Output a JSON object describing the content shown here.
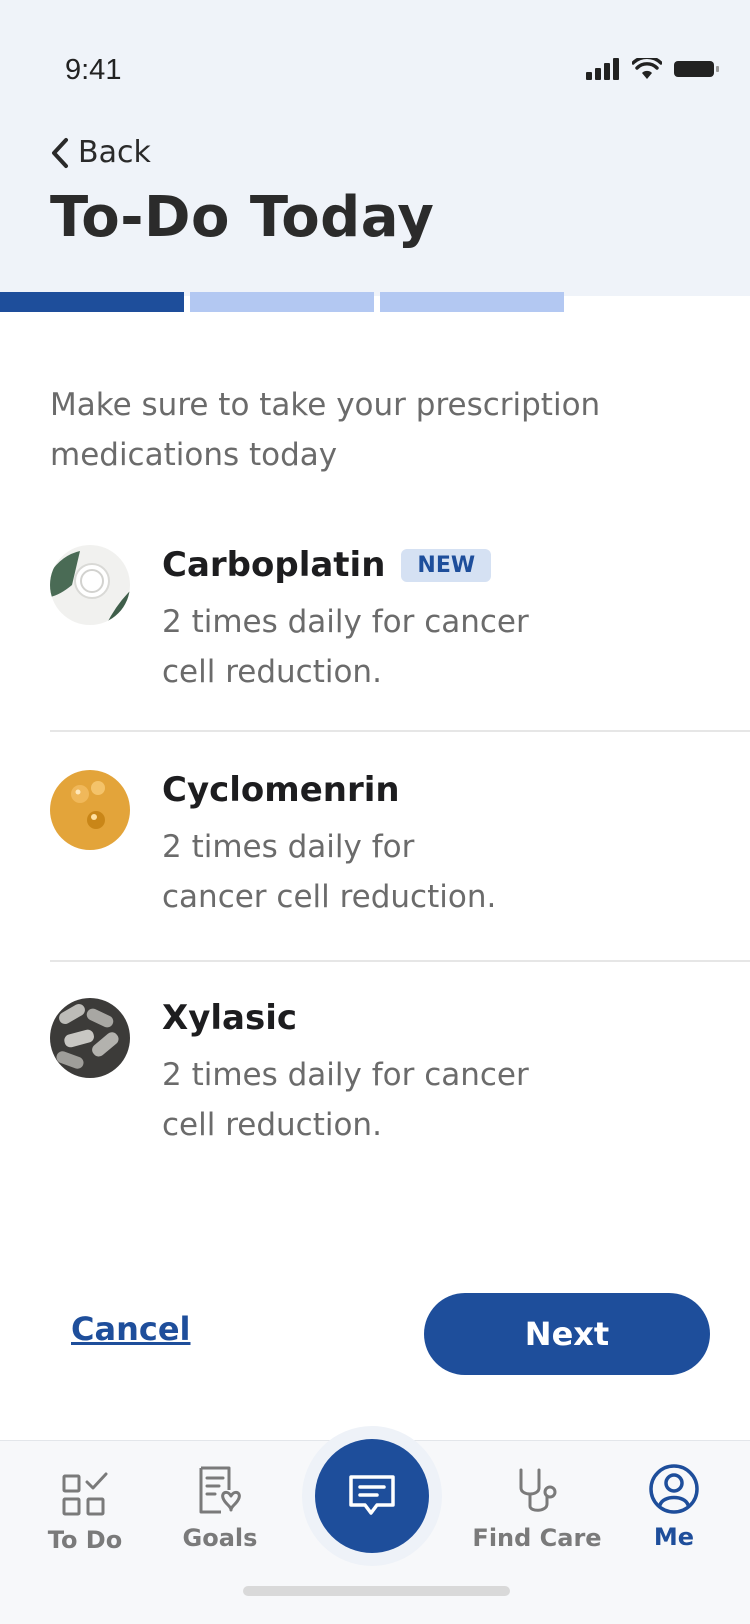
{
  "status_bar": {
    "time": "9:41"
  },
  "nav": {
    "back_label": "Back"
  },
  "page": {
    "title": "To-Do Today"
  },
  "progress": {
    "total_steps": 3,
    "completed_steps": 1
  },
  "intro_text": "Make sure to take your prescription medications today",
  "medications": [
    {
      "name": "Carboplatin",
      "badge": "NEW",
      "desc_line1": "2 times daily for cancer",
      "desc_line2": "cell reduction."
    },
    {
      "name": "Cyclomenrin",
      "desc_line1": "2 times daily for",
      "desc_line2": "cancer cell reduction."
    },
    {
      "name": "Xylasic",
      "desc_line1": "2 times daily for cancer",
      "desc_line2": "cell reduction."
    }
  ],
  "actions": {
    "cancel_label": "Cancel",
    "next_label": "Next"
  },
  "tabbar": {
    "items": [
      {
        "label": "To Do",
        "icon": "todo-grid-check-icon"
      },
      {
        "label": "Goals",
        "icon": "goals-document-icon"
      },
      {
        "label": "",
        "icon": "chat-bubble-icon"
      },
      {
        "label": "Find Care",
        "icon": "stethoscope-icon"
      },
      {
        "label": "Me",
        "icon": "user-circle-icon"
      }
    ],
    "active": "Me"
  },
  "colors": {
    "primary": "#1e4e9b",
    "progress_inactive": "#b3c8f2",
    "header_bg": "#eff3f9",
    "badge_bg": "#d5e1f3"
  }
}
